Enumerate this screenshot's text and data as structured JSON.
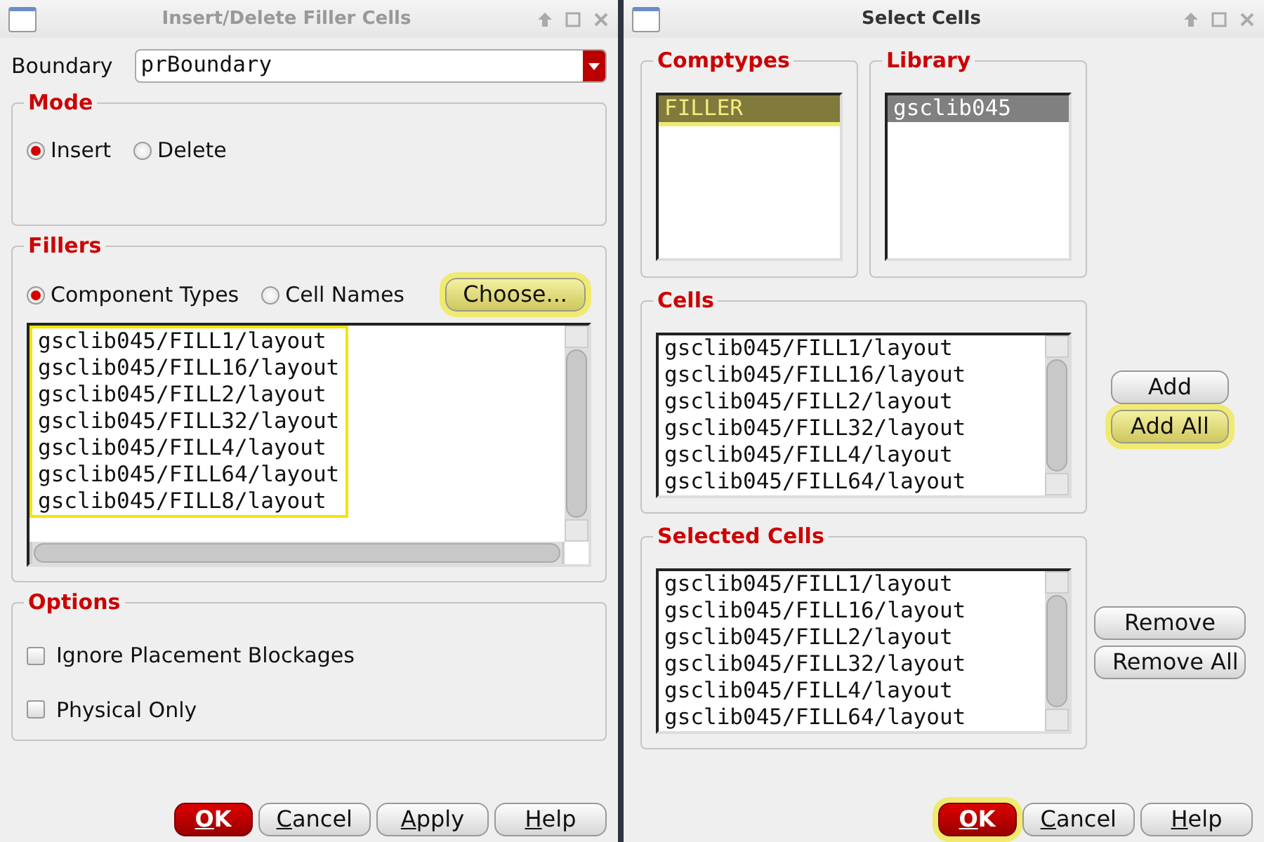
{
  "left_window": {
    "title": "Insert/Delete Filler Cells",
    "boundary": {
      "label": "Boundary",
      "value": "prBoundary"
    },
    "mode": {
      "title": "Mode",
      "options": [
        {
          "label": "Insert",
          "selected": true
        },
        {
          "label": "Delete",
          "selected": false
        }
      ]
    },
    "fillers": {
      "title": "Fillers",
      "options": [
        {
          "label": "Component Types",
          "selected": true
        },
        {
          "label": "Cell Names",
          "selected": false
        }
      ],
      "choose_button": {
        "label": "Choose...",
        "highlighted": true
      },
      "list": {
        "highlighted": true,
        "items": [
          "gsclib045/FILL1/layout",
          "gsclib045/FILL16/layout",
          "gsclib045/FILL2/layout",
          "gsclib045/FILL32/layout",
          "gsclib045/FILL4/layout",
          "gsclib045/FILL64/layout",
          "gsclib045/FILL8/layout"
        ]
      }
    },
    "options": {
      "title": "Options",
      "checkboxes": [
        {
          "label": "Ignore Placement Blockages",
          "checked": false
        },
        {
          "label": "Physical Only",
          "checked": false
        }
      ]
    },
    "buttons": [
      {
        "label": "OK",
        "kind": "default",
        "highlighted": false
      },
      {
        "label": "Cancel",
        "kind": "normal",
        "highlighted": false
      },
      {
        "label": "Apply",
        "kind": "normal",
        "highlighted": false
      },
      {
        "label": "Help",
        "kind": "normal",
        "highlighted": false
      }
    ]
  },
  "right_window": {
    "title": "Select Cells",
    "comptypes": {
      "title": "Comptypes",
      "items": [
        {
          "label": "FILLER",
          "selected": true,
          "highlighted": true
        }
      ]
    },
    "library": {
      "title": "Library",
      "items": [
        {
          "label": "gsclib045",
          "selected": true,
          "highlighted": false
        }
      ]
    },
    "cells": {
      "title": "Cells",
      "items": [
        "gsclib045/FILL1/layout",
        "gsclib045/FILL16/layout",
        "gsclib045/FILL2/layout",
        "gsclib045/FILL32/layout",
        "gsclib045/FILL4/layout",
        "gsclib045/FILL64/layout"
      ]
    },
    "add_buttons": [
      {
        "label": "Add",
        "highlighted": false
      },
      {
        "label": "Add All",
        "highlighted": true
      }
    ],
    "selected_cells": {
      "title": "Selected Cells",
      "items": [
        "gsclib045/FILL1/layout",
        "gsclib045/FILL16/layout",
        "gsclib045/FILL2/layout",
        "gsclib045/FILL32/layout",
        "gsclib045/FILL4/layout",
        "gsclib045/FILL64/layout"
      ]
    },
    "remove_buttons": [
      {
        "label": "Remove",
        "highlighted": false
      },
      {
        "label": "Remove All",
        "highlighted": false
      }
    ],
    "buttons": [
      {
        "label": "OK",
        "kind": "default",
        "highlighted": true
      },
      {
        "label": "Cancel",
        "kind": "normal",
        "highlighted": false
      },
      {
        "label": "Help",
        "kind": "normal",
        "highlighted": false
      }
    ]
  }
}
